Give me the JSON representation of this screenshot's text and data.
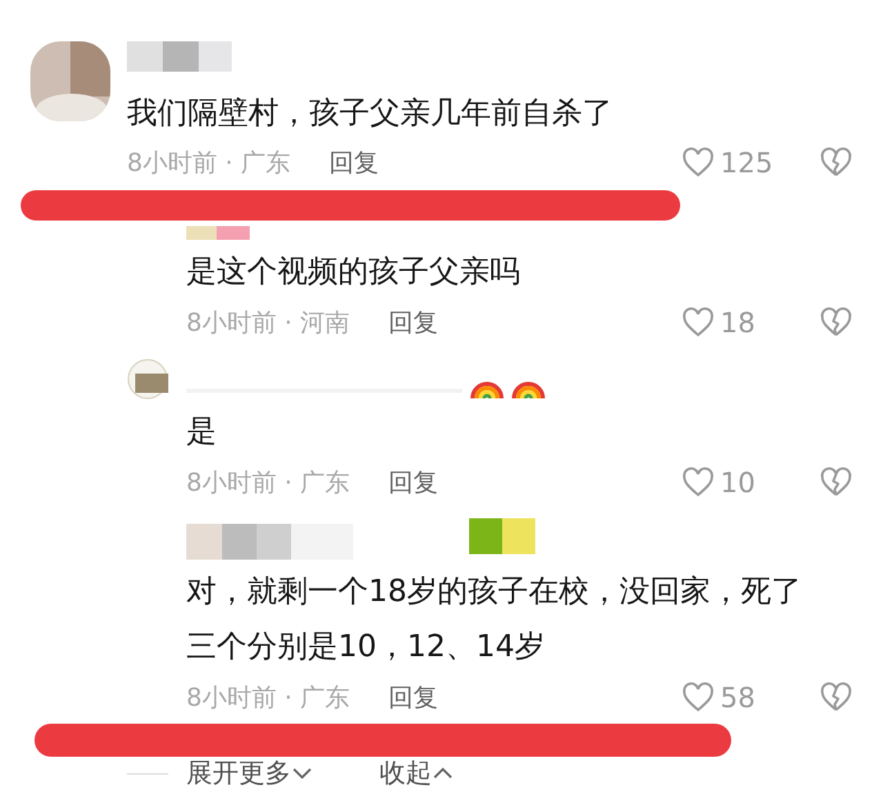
{
  "comments": [
    {
      "kind": "top",
      "avatar": true,
      "text": "我们隔壁村，孩子父亲几年前自杀了",
      "meta": "8小时前 · 广东",
      "reply": "回复",
      "likes": "125"
    },
    {
      "kind": "reply",
      "avatar": false,
      "text": "是这个视频的孩子父亲吗",
      "meta": "8小时前 · 河南",
      "reply": "回复",
      "likes": "18"
    },
    {
      "kind": "reply",
      "avatar": true,
      "badges": [
        {
          "kind": "rainbow"
        },
        {
          "kind": "rainbow"
        }
      ],
      "text": "是",
      "meta": "8小时前 · 广东",
      "reply": "回复",
      "likes": "10"
    },
    {
      "kind": "reply",
      "avatar": false,
      "text": "对，就剩一个18岁的孩子在校，没回家，死了三个分别是10，12、14岁",
      "meta": "8小时前 · 广东",
      "reply": "回复",
      "likes": "58"
    }
  ],
  "footer": {
    "expand": "展开更多",
    "collapse": "收起"
  }
}
